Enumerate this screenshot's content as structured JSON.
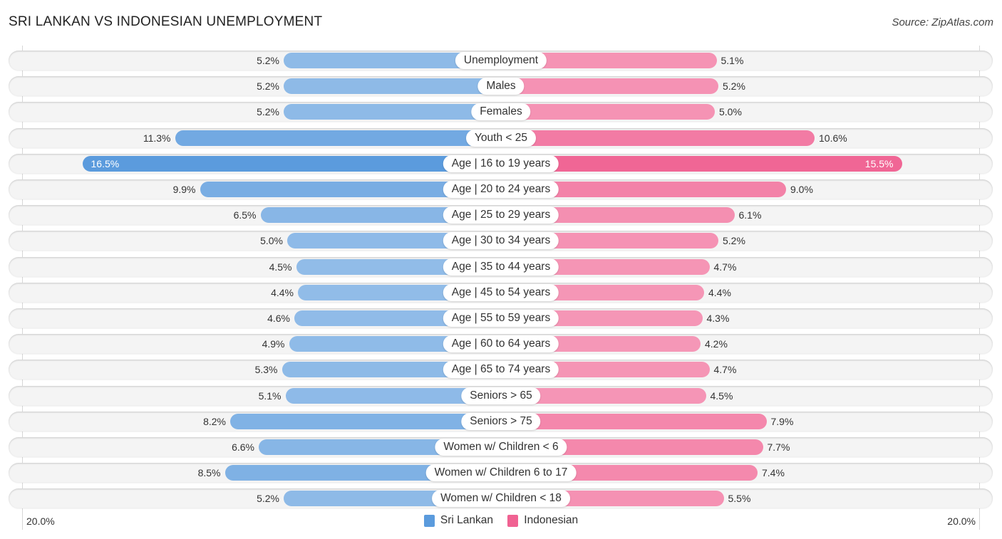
{
  "header": {
    "title": "SRI LANKAN VS INDONESIAN UNEMPLOYMENT",
    "source": "Source: ZipAtlas.com"
  },
  "chart_data": {
    "type": "bar",
    "orientation": "horizontal-diverging",
    "title": "SRI LANKAN VS INDONESIAN UNEMPLOYMENT",
    "categories": [
      "Unemployment",
      "Males",
      "Females",
      "Youth < 25",
      "Age | 16 to 19 years",
      "Age | 20 to 24 years",
      "Age | 25 to 29 years",
      "Age | 30 to 34 years",
      "Age | 35 to 44 years",
      "Age | 45 to 54 years",
      "Age | 55 to 59 years",
      "Age | 60 to 64 years",
      "Age | 65 to 74 years",
      "Seniors > 65",
      "Seniors > 75",
      "Women w/ Children < 6",
      "Women w/ Children 6 to 17",
      "Women w/ Children < 18"
    ],
    "series": [
      {
        "name": "Sri Lankan",
        "side": "left",
        "color": "#5b9bdd",
        "values": [
          5.2,
          5.2,
          5.2,
          11.3,
          16.5,
          9.9,
          6.5,
          5.0,
          4.5,
          4.4,
          4.6,
          4.9,
          5.3,
          5.1,
          8.2,
          6.6,
          8.5,
          5.2
        ],
        "labels": [
          "5.2%",
          "5.2%",
          "5.2%",
          "11.3%",
          "16.5%",
          "9.9%",
          "6.5%",
          "5.0%",
          "4.5%",
          "4.4%",
          "4.6%",
          "4.9%",
          "5.3%",
          "5.1%",
          "8.2%",
          "6.6%",
          "8.5%",
          "5.2%"
        ]
      },
      {
        "name": "Indonesian",
        "side": "right",
        "color": "#f06292",
        "values": [
          5.1,
          5.2,
          5.0,
          10.6,
          15.5,
          9.0,
          6.1,
          5.2,
          4.7,
          4.4,
          4.3,
          4.2,
          4.7,
          4.5,
          7.9,
          7.7,
          7.4,
          5.5
        ],
        "labels": [
          "5.1%",
          "5.2%",
          "5.0%",
          "10.6%",
          "15.5%",
          "9.0%",
          "6.1%",
          "5.2%",
          "4.7%",
          "4.4%",
          "4.3%",
          "4.2%",
          "4.7%",
          "4.5%",
          "7.9%",
          "7.7%",
          "7.4%",
          "5.5%"
        ]
      }
    ],
    "xlim": [
      0,
      20.0
    ],
    "axis_ticks": {
      "left": "20.0%",
      "right": "20.0%"
    },
    "legend": {
      "position": "bottom-center",
      "entries": [
        "Sri Lankan",
        "Indonesian"
      ]
    },
    "grid": false
  }
}
